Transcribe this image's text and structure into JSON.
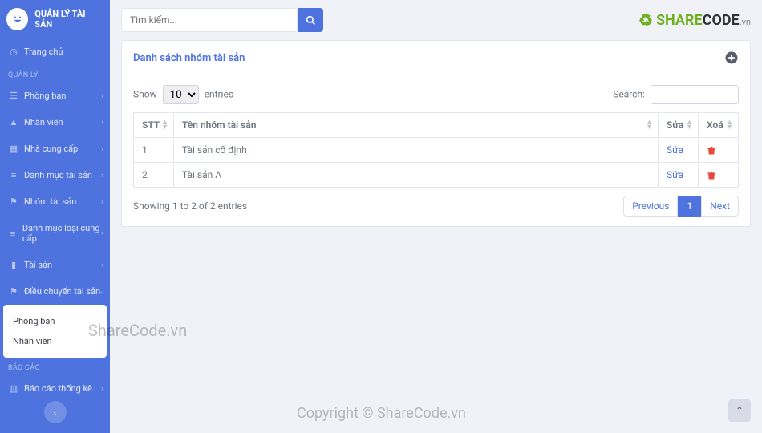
{
  "brand": {
    "title": "QUẢN LÝ TÀI SẢN"
  },
  "nav": {
    "home": "Trang chủ",
    "heading_manage": "QUẢN LÝ",
    "phongban": "Phòng ban",
    "nhanvien": "Nhân viên",
    "nhacungcap": "Nhà cung cấp",
    "danhmuctaisan": "Danh mục tài sản",
    "nhomtaisan": "Nhóm tài sản",
    "danhmucloai": "Danh mục loại cung cấp",
    "taisan": "Tài sản",
    "dieuchuyen": "Điều chuyển tài sản",
    "sub_phongban": "Phòng ban",
    "sub_nhanvien": "Nhân viên",
    "heading_report": "BÁO CÁO",
    "baocao": "Báo cáo thống kê"
  },
  "search": {
    "placeholder": "Tìm kiếm..."
  },
  "logo": {
    "share": "SHARE",
    "code": "CODE",
    "sub": ".vn"
  },
  "card": {
    "title": "Danh sách nhóm tài sản",
    "show_pre": "Show",
    "show_value": "10",
    "show_post": "entries",
    "search_label": "Search:",
    "cols": {
      "stt": "STT",
      "ten": "Tên nhóm tài sản",
      "sua": "Sửa",
      "xoa": "Xoá"
    },
    "rows": [
      {
        "stt": "1",
        "ten": "Tài sản cố định",
        "sua": "Sửa"
      },
      {
        "stt": "2",
        "ten": "Tài sản A",
        "sua": "Sửa"
      }
    ],
    "info": "Showing 1 to 2 of 2 entries",
    "page_prev": "Previous",
    "page_1": "1",
    "page_next": "Next"
  },
  "watermarks": {
    "w1": "ShareCode.vn",
    "w2": "Copyright © ShareCode.vn"
  }
}
